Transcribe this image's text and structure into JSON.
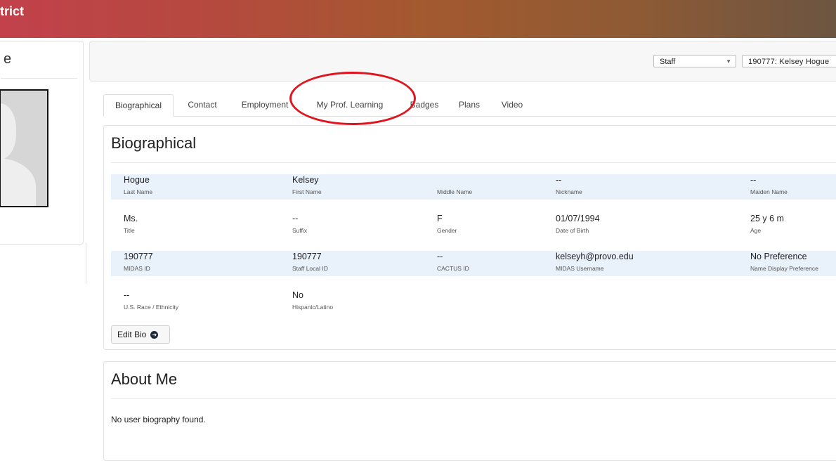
{
  "banner": {
    "title": "trict"
  },
  "left_panel": {
    "heading": "e"
  },
  "toolbar": {
    "role_select": "Staff",
    "person_select": "190777: Kelsey Hogue"
  },
  "tabs": [
    "Biographical",
    "Contact",
    "Employment",
    "My Prof. Learning",
    "Badges",
    "Plans",
    "Video"
  ],
  "active_tab": "Biographical",
  "bio": {
    "title": "Biographical",
    "rows": [
      [
        {
          "value": "Hogue",
          "label": "Last Name"
        },
        {
          "value": "Kelsey",
          "label": "First Name"
        },
        {
          "value": "",
          "label": "Middle Name"
        },
        {
          "value": "--",
          "label": "Nickname"
        },
        {
          "value": "--",
          "label": "Maiden Name"
        }
      ],
      [
        {
          "value": "Ms.",
          "label": "Title"
        },
        {
          "value": "--",
          "label": "Suffix"
        },
        {
          "value": "F",
          "label": "Gender"
        },
        {
          "value": "01/07/1994",
          "label": "Date of Birth"
        },
        {
          "value": "25 y 6 m",
          "label": "Age"
        }
      ],
      [
        {
          "value": "190777",
          "label": "MIDAS ID"
        },
        {
          "value": "190777",
          "label": "Staff Local ID"
        },
        {
          "value": "--",
          "label": "CACTUS ID"
        },
        {
          "value": "kelseyh@provo.edu",
          "label": "MIDAS Username"
        },
        {
          "value": "No Preference",
          "label": "Name Display Preference"
        }
      ],
      [
        {
          "value": "--",
          "label": "U.S. Race / Ethnicity"
        },
        {
          "value": "No",
          "label": "Hispanic/Latino"
        }
      ]
    ],
    "edit_button": "Edit Bio"
  },
  "about": {
    "title": "About Me",
    "text": "No user biography found."
  },
  "colors": {
    "banner_start": "#c2414b",
    "banner_end": "#6c5541",
    "shaded_row": "#e9f1fb",
    "annotation": "#e0141e"
  },
  "icons": {
    "edit_button_icon": "circle-arrow-right-icon",
    "select_caret": "caret-down-icon"
  }
}
